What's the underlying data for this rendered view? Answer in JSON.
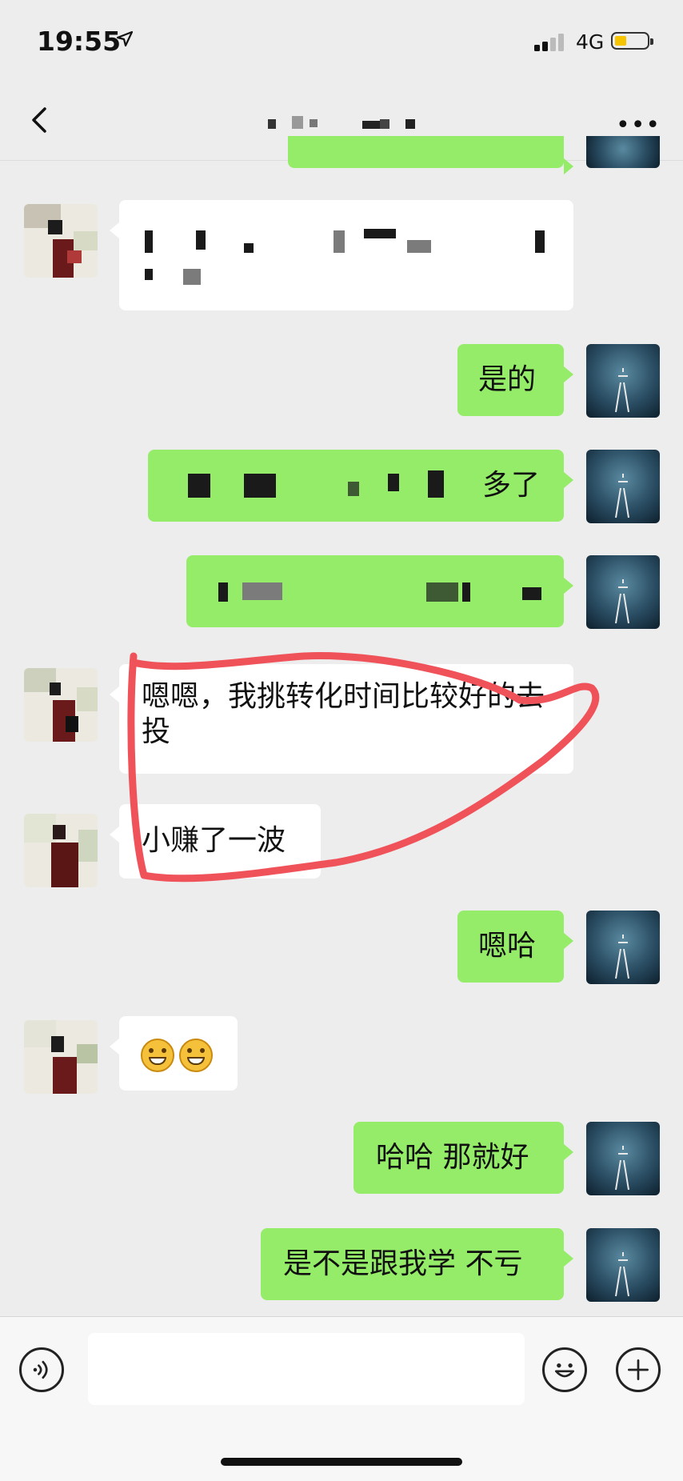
{
  "status_bar": {
    "time": "19:55",
    "network": "4G"
  },
  "header": {
    "back_icon": "chevron-left-icon",
    "more_label": "•••"
  },
  "messages": [
    {
      "side": "in",
      "text": ""
    },
    {
      "side": "out",
      "text": "是的"
    },
    {
      "side": "out",
      "text": "多了"
    },
    {
      "side": "out",
      "text": ""
    },
    {
      "side": "in",
      "text": "嗯嗯，我挑转化时间比较好的去投"
    },
    {
      "side": "in",
      "text": "小赚了一波"
    },
    {
      "side": "out",
      "text": "嗯哈"
    },
    {
      "side": "in",
      "text": ""
    },
    {
      "side": "out",
      "text": "哈哈 那就好"
    },
    {
      "side": "out",
      "text": "是不是跟我学 不亏"
    }
  ],
  "input_bar": {
    "voice_icon": "voice-icon",
    "emoji_icon": "emoji-icon",
    "plus_icon": "plus-icon"
  },
  "colors": {
    "outgoing_bubble": "#95ec69",
    "incoming_bubble": "#ffffff",
    "annotation": "#f0525a"
  }
}
